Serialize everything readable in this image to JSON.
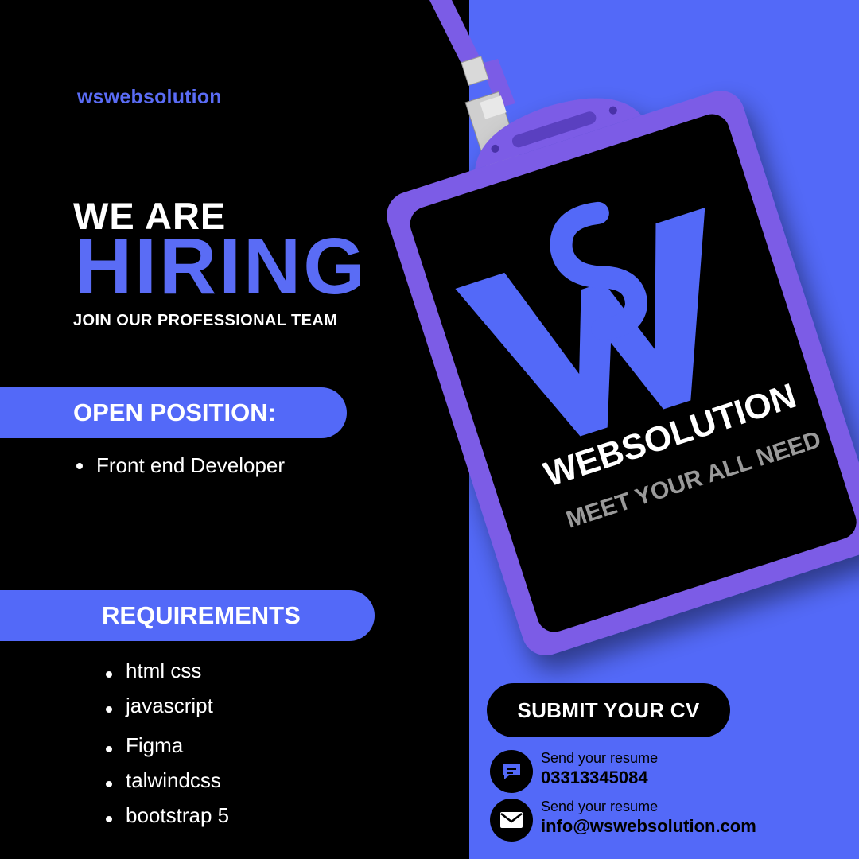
{
  "brand": "wswebsolution",
  "headline": {
    "line1": "WE ARE",
    "line2": "HIRING",
    "tagline": "JOIN OUR PROFESSIONAL TEAM"
  },
  "open_position": {
    "title": "OPEN POSITION:",
    "items": [
      "Front end Developer"
    ]
  },
  "requirements": {
    "title": "REQUIREMENTS",
    "items": [
      "html css",
      "javascript",
      "Figma",
      "talwindcss",
      "bootstrap 5"
    ]
  },
  "badge": {
    "logo_letters": "WS",
    "company": "WEBSOLUTION",
    "slogan": "MEET YOUR ALL NEED"
  },
  "cta": {
    "label": "SUBMIT YOUR CV"
  },
  "contacts": [
    {
      "label": "Send your resume",
      "value": "03313345084",
      "icon": "message-icon"
    },
    {
      "label": "Send your resume",
      "value": "info@wswebsolution.com",
      "icon": "mail-icon"
    }
  ],
  "colors": {
    "accent": "#5369f8",
    "text_accent": "#5a6cf5",
    "background": "#000000",
    "lanyard": "#7b5ce6"
  }
}
